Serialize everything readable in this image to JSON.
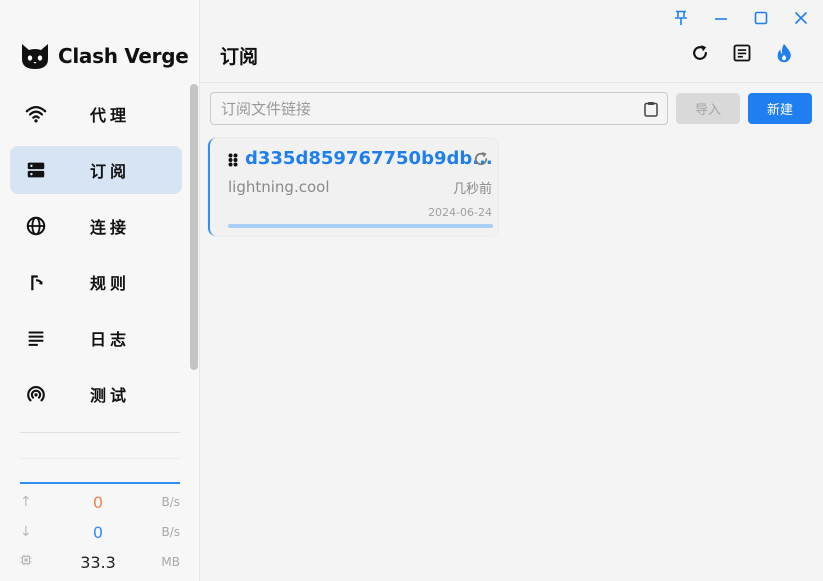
{
  "app": {
    "name": "Clash Verge"
  },
  "sidebar": {
    "items": [
      {
        "label": "代理",
        "icon": "wifi-icon",
        "active": false
      },
      {
        "label": "订阅",
        "icon": "storage-icon",
        "active": true
      },
      {
        "label": "连接",
        "icon": "globe-icon",
        "active": false
      },
      {
        "label": "规则",
        "icon": "fork-arrow-icon",
        "active": false
      },
      {
        "label": "日志",
        "icon": "list-lines-icon",
        "active": false
      },
      {
        "label": "测试",
        "icon": "radar-icon",
        "active": false
      }
    ],
    "stats": {
      "upload": {
        "value": "0",
        "unit": "B/s"
      },
      "download": {
        "value": "0",
        "unit": "B/s"
      },
      "memory": {
        "value": "33.3",
        "unit": "MB"
      }
    }
  },
  "header": {
    "title": "订阅"
  },
  "toolbar": {
    "url_placeholder": "订阅文件链接",
    "import_label": "导入",
    "new_label": "新建"
  },
  "profile": {
    "name": "d335d859767750b9db...",
    "host": "lightning.cool",
    "updated": "几秒前",
    "date": "2024-06-24",
    "progress": 1.0
  },
  "colors": {
    "accent": "#1f7ff0",
    "active_bg": "#d6e4f3",
    "upload": "#f27f55",
    "download": "#2f8df5"
  }
}
